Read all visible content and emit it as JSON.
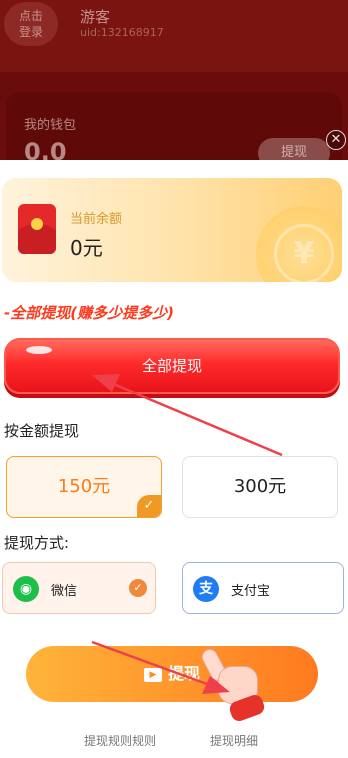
{
  "background": {
    "login_button": "点击\n登录",
    "username": "游客",
    "uid": "uid:132168917",
    "wallet_title": "我的钱包",
    "wallet_amount": "0.0",
    "wallet_button": "提现"
  },
  "dialog": {
    "close_icon": "close-icon",
    "balance_label": "当前余额",
    "balance_value": "0元",
    "slogan": "-全部提现(赚多少提多少)",
    "withdraw_all_label": "全部提现",
    "amount_title": "按金额提现",
    "amount_options": [
      {
        "label": "150元",
        "selected": true
      },
      {
        "label": "300元",
        "selected": false
      }
    ],
    "method_title": "提现方式:",
    "methods": [
      {
        "label": "微信",
        "icon": "wechat-icon",
        "selected": true
      },
      {
        "label": "支付宝",
        "icon": "alipay-icon",
        "selected": false
      }
    ],
    "withdraw_button_label": "提现",
    "rules_link": "提现规则规则",
    "detail_link": "提现明细"
  },
  "colors": {
    "accent_red": "#ff2a2a",
    "accent_orange": "#ff7a1f",
    "selected_border": "#f0a12f"
  }
}
